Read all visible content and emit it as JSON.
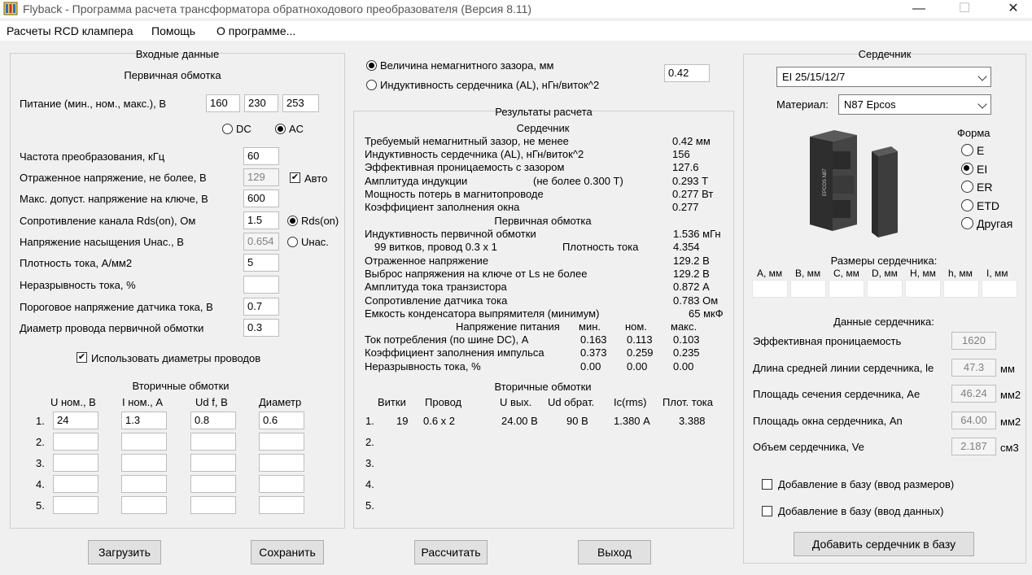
{
  "window": {
    "title": "Flyback - Программа расчета трансформатора обратноходового преобразователя (Версия 8.11)",
    "minimize": "—",
    "maximize": "☐",
    "close": "✕"
  },
  "menu": [
    "Расчеты RCD клампера",
    "Помощь",
    "О программе..."
  ],
  "input": {
    "title": "Входные данные",
    "primary_title": "Первичная обмотка",
    "supply_label": "Питание (мин., ном., макс.), В",
    "supply_values": [
      "160",
      "230",
      "253"
    ],
    "dc_label": "DC",
    "ac_label": "AC",
    "freq_label": "Частота преобразования, кГц",
    "freq_value": "60",
    "refl_label": "Отраженное напряжение, не более, В",
    "refl_value": "129",
    "auto_label": "Авто",
    "vmax_label": "Макс. допуст. напряжение на ключе, В",
    "vmax_value": "600",
    "rds_label": "Сопротивление канала Rds(on), Ом",
    "rds_value": "1.5",
    "rds_radio": "Rds(on)",
    "usat_label": "Напряжение насыщения Uнас., В",
    "usat_value": "0.654",
    "usat_radio": "Uнас.",
    "j_label": "Плотность тока, А/мм2",
    "j_value": "5",
    "cont_label": "Неразрывность тока, %",
    "cont_value": "",
    "sense_label": "Пороговое напряжение датчика тока, В",
    "sense_value": "0.7",
    "diam_label": "Диаметр провода первичной обмотки",
    "diam_value": "0.3",
    "use_diam_label": "Использовать диаметры проводов",
    "secondary_title": "Вторичные обмотки",
    "sec_headers": [
      "U ном., В",
      "I ном., А",
      "Ud f, В",
      "Диаметр"
    ],
    "sec_rows": [
      {
        "n": "1.",
        "u": "24",
        "i": "1.3",
        "ud": "0.8",
        "d": "0.6"
      },
      {
        "n": "2.",
        "u": "",
        "i": "",
        "ud": "",
        "d": ""
      },
      {
        "n": "3.",
        "u": "",
        "i": "",
        "ud": "",
        "d": ""
      },
      {
        "n": "4.",
        "u": "",
        "i": "",
        "ud": "",
        "d": ""
      },
      {
        "n": "5.",
        "u": "",
        "i": "",
        "ud": "",
        "d": ""
      }
    ]
  },
  "gap": {
    "gap_label": "Величина немагнитного зазора, мм",
    "al_label": "Индуктивность сердечника (AL), нГн/виток^2",
    "value": "0.42"
  },
  "results": {
    "title": "Результаты расчета",
    "core_title": "Сердечник",
    "core_rows": [
      {
        "label": "Требуемый немагнитный зазор, не менее",
        "value": "0.42 мм"
      },
      {
        "label": "Индуктивность сердечника (AL), нГн/виток^2",
        "value": "156"
      },
      {
        "label": "Эффективная проницаемость с зазором",
        "value": "127.6"
      },
      {
        "label": "Амплитуда индукции",
        "extra": "(не более 0.300 Т)",
        "value": "0.293 Т"
      },
      {
        "label": "Мощность потерь в магнитопроводе",
        "value": "0.277 Вт"
      },
      {
        "label": "Коэффициент заполнения окна",
        "value": "0.277"
      }
    ],
    "primary_title": "Первичная обмотка",
    "primary_rows": [
      {
        "label": "Индуктивность первичной обмотки",
        "value": "1.536 мГн"
      },
      {
        "label": "99 витков, провод 0.3 х 1",
        "extra": "Плотность тока",
        "value": "4.354"
      },
      {
        "label": "Отраженное напряжение",
        "value": "129.2 В"
      },
      {
        "label": "Выброс напряжения на ключе от Ls не более",
        "value": "129.2 В"
      },
      {
        "label": "Амплитуда тока транзистора",
        "value": "0.872 А"
      },
      {
        "label": "Сопротивление датчика тока",
        "value": "0.783 Ом"
      },
      {
        "label": "Емкость конденсатора выпрямителя (минимум)",
        "value": "65 мкФ"
      }
    ],
    "supply_header": {
      "label": "Напряжение питания",
      "min": "мин.",
      "nom": "ном.",
      "max": "макс."
    },
    "supply_rows": [
      {
        "label": "Ток потребления (по шине DC), А",
        "min": "0.163",
        "nom": "0.113",
        "max": "0.103"
      },
      {
        "label": "Коэффициент заполнения импульса",
        "min": "0.373",
        "nom": "0.259",
        "max": "0.235"
      },
      {
        "label": "Неразрывность тока, %",
        "min": "0.00",
        "nom": "0.00",
        "max": "0.00"
      }
    ],
    "secondary_title": "Вторичные обмотки",
    "sec_headers": [
      "Витки",
      "Провод",
      "U вых.",
      "Ud обрат.",
      "Ic(rms)",
      "Плот. тока"
    ],
    "sec_rows": [
      {
        "n": "1.",
        "turns": "19",
        "wire": "0.6 х 2",
        "u": "24.00 В",
        "ud": "90 В",
        "ic": "1.380 А",
        "j": "3.388"
      },
      {
        "n": "2."
      },
      {
        "n": "3."
      },
      {
        "n": "4."
      },
      {
        "n": "5."
      }
    ]
  },
  "core": {
    "title": "Сердечник",
    "selected": "EI 25/15/12/7",
    "material_label": "Материал:",
    "material": "N87 Epcos",
    "shape_title": "Форма",
    "shapes": [
      "E",
      "EI",
      "ER",
      "ETD",
      "Другая"
    ],
    "shape_selected": "EI",
    "image_text": "EPCOS N87",
    "dims_title": "Размеры сердечника:",
    "dims": [
      "A, мм",
      "B, мм",
      "C, мм",
      "D, мм",
      "H, мм",
      "h, мм",
      "I, мм"
    ],
    "data_title": "Данные сердечника:",
    "data_rows": [
      {
        "label": "Эффективная проницаемость",
        "value": "1620",
        "unit": ""
      },
      {
        "label": "Длина средней линии сердечника, le",
        "value": "47.3",
        "unit": "мм"
      },
      {
        "label": "Площадь сечения сердечника, Ae",
        "value": "46.24",
        "unit": "мм2"
      },
      {
        "label": "Площадь окна сердечника, An",
        "value": "64.00",
        "unit": "мм2"
      },
      {
        "label": "Объем сердечника, Ve",
        "value": "2.187",
        "unit": "см3"
      }
    ],
    "add_dims_label": "Добавление в базу (ввод размеров)",
    "add_data_label": "Добавление в базу (ввод данных)",
    "add_button": "Добавить сердечник в базу"
  },
  "buttons": {
    "load": "Загрузить",
    "save": "Сохранить",
    "calc": "Рассчитать",
    "exit": "Выход"
  }
}
